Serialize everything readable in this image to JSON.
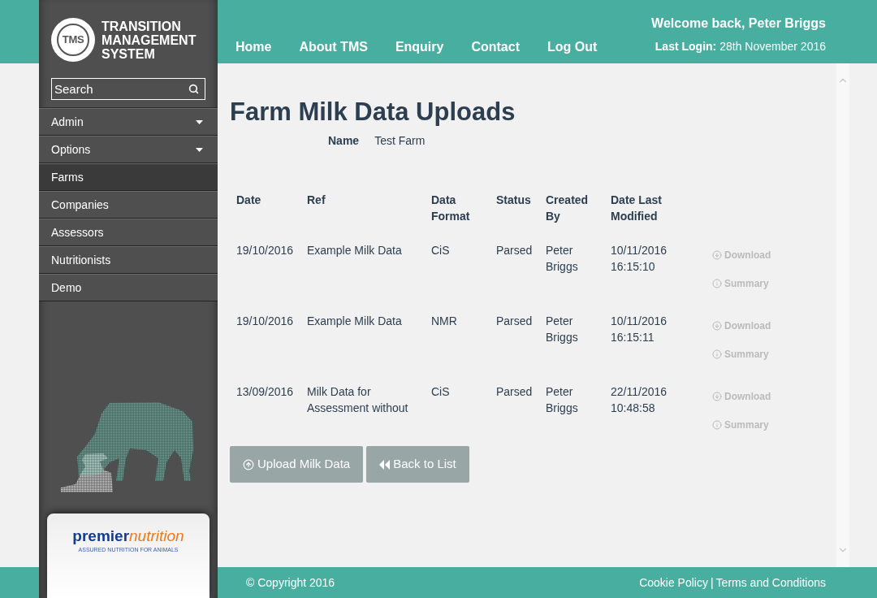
{
  "logo": {
    "mark": "TMS",
    "lines": [
      "TRANSITION",
      "MANAGEMENT",
      "SYSTEM"
    ]
  },
  "search": {
    "placeholder": "Search"
  },
  "sidebar": {
    "items": [
      {
        "label": "Admin",
        "dropdown": true,
        "selected": false
      },
      {
        "label": "Options",
        "dropdown": true,
        "selected": false
      },
      {
        "label": "Farms",
        "dropdown": false,
        "selected": true
      },
      {
        "label": "Companies",
        "dropdown": false,
        "selected": false
      },
      {
        "label": "Assessors",
        "dropdown": false,
        "selected": false
      },
      {
        "label": "Nutritionists",
        "dropdown": false,
        "selected": false
      },
      {
        "label": "Demo",
        "dropdown": false,
        "selected": false
      }
    ]
  },
  "sponsor": {
    "brand": "premier",
    "brand_accent": "nutrition",
    "tagline": "ASSURED NUTRITION FOR ANIMALS"
  },
  "nav": [
    "Home",
    "About TMS",
    "Enquiry",
    "Contact",
    "Log Out"
  ],
  "user": {
    "welcome": "Welcome back, Peter Briggs",
    "last_login_label": "Last Login:",
    "last_login": "28th November 2016"
  },
  "page": {
    "title": "Farm Milk Data Uploads",
    "name_label": "Name",
    "name_value": "Test Farm"
  },
  "table": {
    "columns": [
      "Date",
      "Ref",
      "Data Format",
      "Status",
      "Created By",
      "Date Last Modified"
    ],
    "rows": [
      {
        "cells": [
          "19/10/2016",
          "Example Milk Data",
          "CiS",
          "Parsed",
          "Peter Briggs",
          "10/11/2016 16:15:10"
        ],
        "actions": [
          "Download",
          "Summary"
        ]
      },
      {
        "cells": [
          "19/10/2016",
          "Example Milk Data",
          "NMR",
          "Parsed",
          "Peter Briggs",
          "10/11/2016 16:15:11"
        ],
        "actions": [
          "Download",
          "Summary"
        ]
      },
      {
        "cells": [
          "13/09/2016",
          "Milk Data for Assessment without",
          "CiS",
          "Parsed",
          "Peter Briggs",
          "22/11/2016 10:48:58"
        ],
        "actions": [
          "Download",
          "Summary"
        ]
      }
    ]
  },
  "buttons": [
    {
      "kind": "upload",
      "label": "Upload Milk Data"
    },
    {
      "kind": "back",
      "label": "Back to List"
    }
  ],
  "footer": {
    "copyright": "© Copyright 2016",
    "links": [
      "Cookie Policy",
      "Terms and Conditions"
    ],
    "separator": "|"
  }
}
